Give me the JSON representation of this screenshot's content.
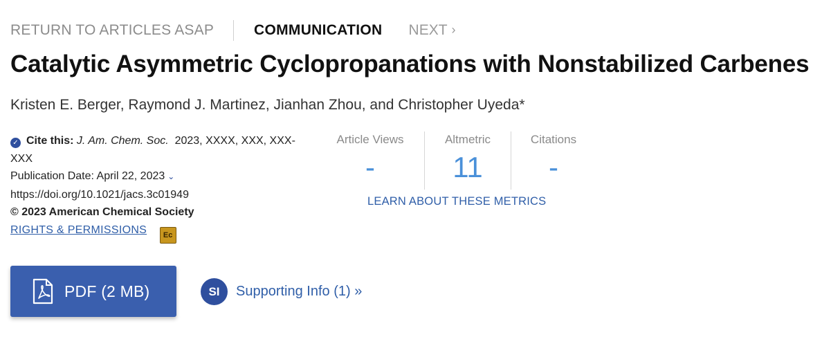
{
  "nav": {
    "return_label": "RETURN TO ARTICLES ASAP",
    "article_type": "COMMUNICATION",
    "next_label": "NEXT",
    "next_chevron": "›"
  },
  "article": {
    "title": "Catalytic Asymmetric Cyclopropanations with Nonstabilized Carbenes",
    "authors": "Kristen E. Berger, Raymond J. Martinez, Jianhan Zhou, and Christopher Uyeda*"
  },
  "citation": {
    "cite_label": "Cite this:",
    "journal": "J. Am. Chem. Soc.",
    "ref_line1": "2023, XXXX, XXX, XXX-",
    "ref_line2": "XXX",
    "pub_date": "Publication Date: April 22, 2023",
    "doi": "https://doi.org/10.1021/jacs.3c01949",
    "copyright": "© 2023 American Chemical Society",
    "rights_label": "RIGHTS & PERMISSIONS",
    "cc_badge": "Ec"
  },
  "metrics": {
    "items": [
      {
        "label": "Article Views",
        "value": "-"
      },
      {
        "label": "Altmetric",
        "value": "11"
      },
      {
        "label": "Citations",
        "value": "-"
      }
    ],
    "learn_label": "LEARN ABOUT THESE METRICS"
  },
  "actions": {
    "pdf_label": "PDF (2 MB)",
    "si_badge": "SI",
    "si_label": "Supporting Info (1) »"
  },
  "colors": {
    "accent_blue": "#3a5fae",
    "link_blue": "#2f5ea8",
    "metric_value": "#4a90d9"
  }
}
